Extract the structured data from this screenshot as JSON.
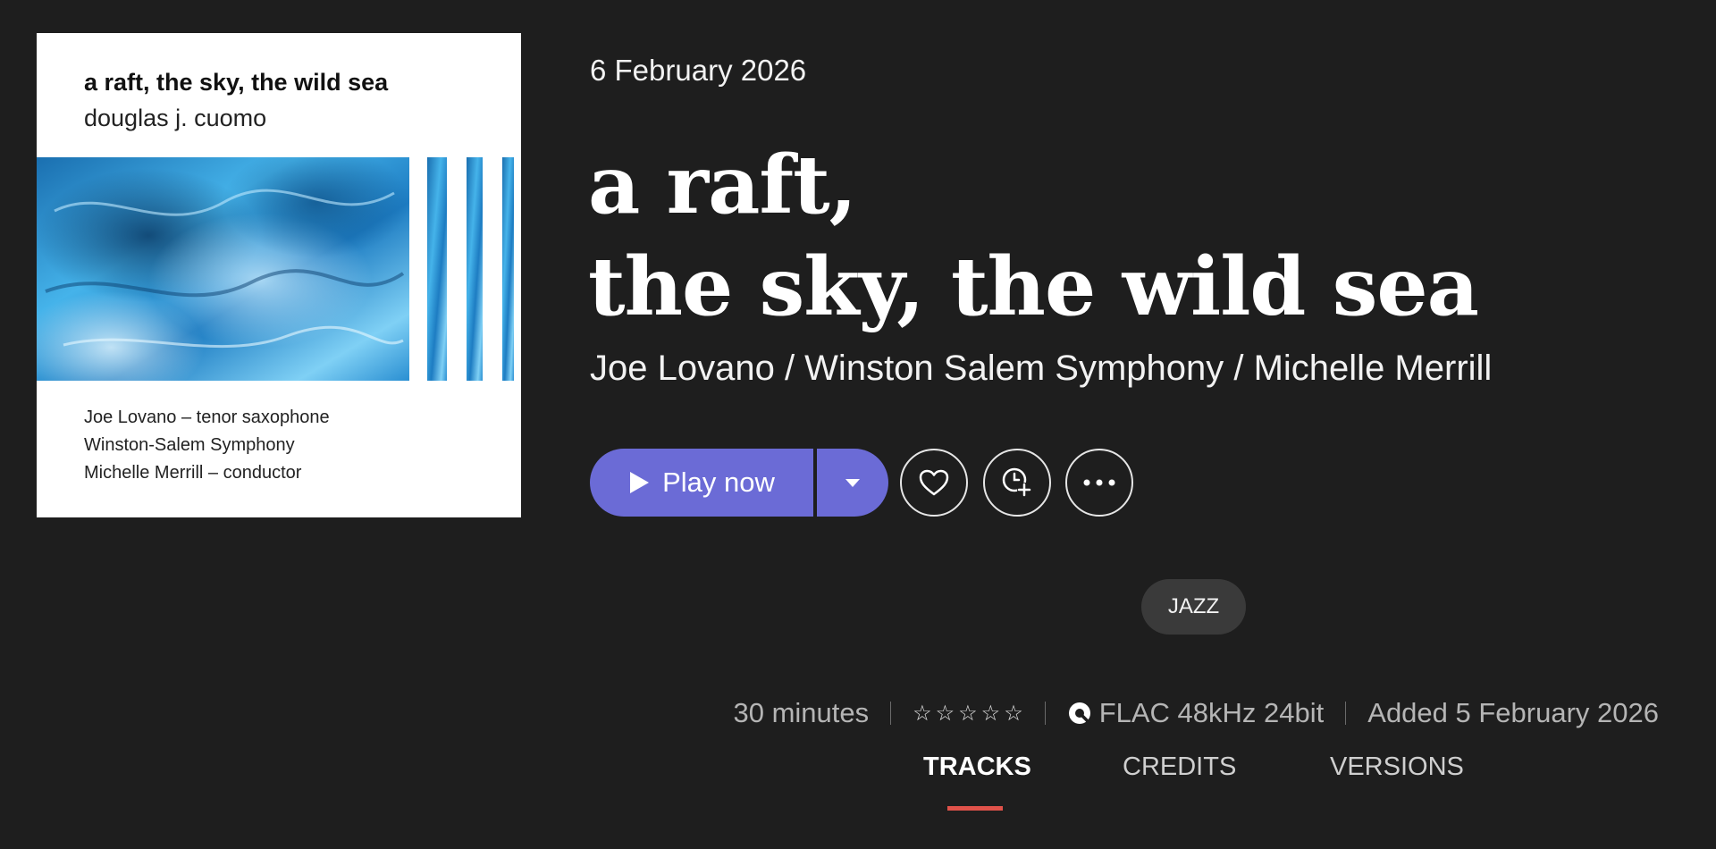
{
  "cover": {
    "title": "a raft, the sky, the wild sea",
    "composer": "douglas j. cuomo",
    "credits": [
      "Joe Lovano – tenor saxophone",
      "Winston-Salem Symphony",
      "Michelle Merrill – conductor"
    ],
    "art_color": "#2f9fdc"
  },
  "album": {
    "release_date": "6 February 2026",
    "title_lines": [
      "a raft,",
      "the sky, the wild sea"
    ],
    "artists": "Joe Lovano / Winston Salem Symphony / Michelle Merrill"
  },
  "actions": {
    "play_label": "Play now",
    "accent_color": "#6b6bd6",
    "icons": [
      "play-icon",
      "chevron-down-icon",
      "heart-icon",
      "clock-plus-icon",
      "more-icon"
    ]
  },
  "genre": "JAZZ",
  "meta": {
    "duration": "30 minutes",
    "rating": "0 of 5 stars",
    "quality": "FLAC 48kHz 24bit",
    "added": "Added 5 February 2026"
  },
  "tabs": [
    {
      "label": "TRACKS",
      "active": true
    },
    {
      "label": "CREDITS",
      "active": false
    },
    {
      "label": "VERSIONS",
      "active": false
    }
  ],
  "tab_underline_color": "#e0524a"
}
